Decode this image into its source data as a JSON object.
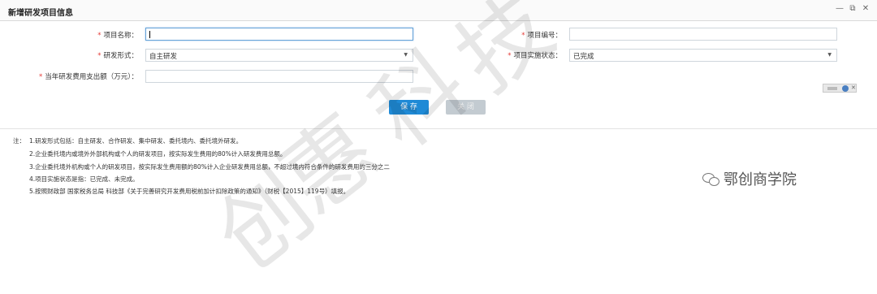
{
  "window": {
    "title": "新增研发项目信息",
    "controls": [
      "minimize-icon",
      "maximize-icon",
      "close-icon"
    ]
  },
  "form": {
    "project_name": {
      "label": "项目名称：",
      "value": ""
    },
    "project_code": {
      "label": "项目编号：",
      "value": ""
    },
    "rd_form": {
      "label": "研发形式：",
      "value": "自主研发"
    },
    "implementation_status": {
      "label": "项目实施状态：",
      "value": "已完成"
    },
    "annual_expense": {
      "label": "当年研发费用支出额（万元）：",
      "value": ""
    }
  },
  "buttons": {
    "save": "保 存",
    "close": "关 闭"
  },
  "notes": {
    "prefix": "注：",
    "lines": [
      "1.研发形式包括：自主研发、合作研发、集中研发、委托境内、委托境外研发。",
      "2.企业委托境内或境外外部机构或个人的研发项目，按实际发生费用的80%计入研发费用总额。",
      "3.企业委托境外机构或个人的研发项目，按实际发生费用额的80%计入企业研发费用总额，不超过境内符合条件的研发费用的三分之二",
      "4.项目实施状态是指：已完成、未完成。",
      "5.按照财政部 国家税务总局 科技部《关于完善研究开发费用税前加计扣除政策的通知》（财税【2015】119号）填报。"
    ]
  },
  "watermark": {
    "chars": [
      "创",
      "惠",
      "科",
      "技"
    ],
    "wechat_label": "鄂创商学院"
  },
  "colors": {
    "required": "#e53935",
    "save_button": "#1f8ad6",
    "close_button": "#c3cbd1",
    "focus_border": "#66a3d9"
  }
}
